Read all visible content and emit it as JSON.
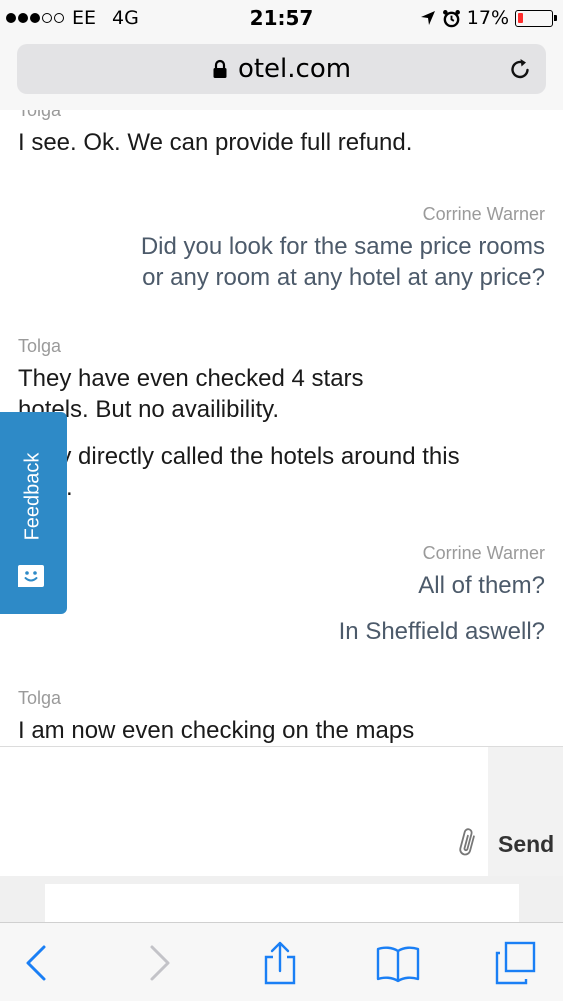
{
  "status_bar": {
    "carrier": "EE",
    "network": "4G",
    "time": "21:57",
    "battery_percent": "17%",
    "battery_level": 0.17,
    "signal_bars_filled": 3,
    "signal_bars_total": 5
  },
  "browser": {
    "url": "otel.com",
    "lock_icon": "lock-icon",
    "reload_icon": "reload-icon"
  },
  "chat": {
    "messages": [
      {
        "sender": "Tolga",
        "lines": [
          "I see. Ok. We can provide full refund."
        ]
      },
      {
        "sender": "Corrine Warner",
        "lines": [
          "Did you look for the same price rooms",
          "or any room at any hotel at any price?"
        ]
      },
      {
        "sender": "Tolga",
        "lines": [
          "They have even checked 4 stars",
          "hotels. But no availibility.",
          "They directly called the hotels around this",
          "area."
        ]
      },
      {
        "sender": "Corrine Warner",
        "lines": [
          "All of them?",
          "In Sheffield aswell?"
        ]
      },
      {
        "sender": "Tolga",
        "lines": [
          "I am now even checking on the maps"
        ]
      }
    ]
  },
  "feedback": {
    "label": "Feedback",
    "icon": "smiley-chat-icon"
  },
  "composer": {
    "send_label": "Send",
    "attach_icon": "paperclip-icon",
    "input_value": ""
  },
  "toolbar": {
    "icons": [
      "back-icon",
      "forward-icon",
      "share-icon",
      "bookmarks-icon",
      "tabs-icon"
    ]
  },
  "colors": {
    "feedback_bg": "#2e8ac7",
    "agent_text": "#4c5a6a",
    "ios_blue": "#1a7ff5",
    "battery_low": "#ff2d2d"
  }
}
